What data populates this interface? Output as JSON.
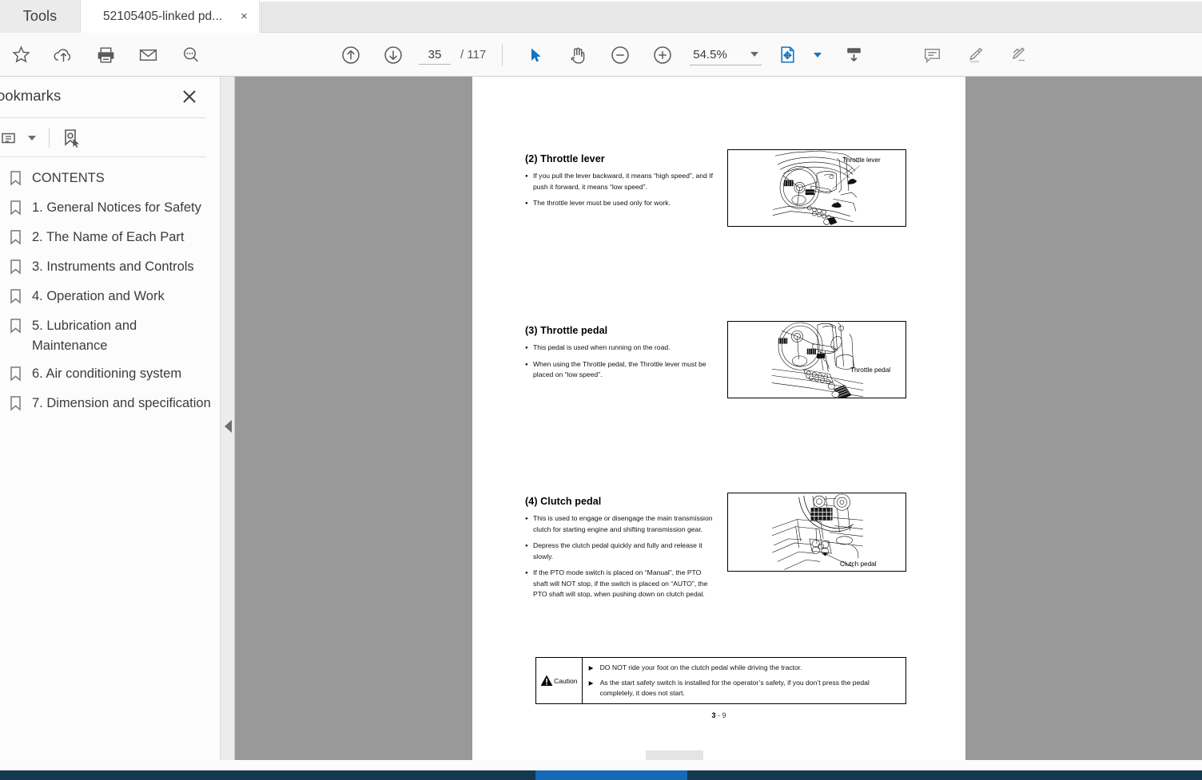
{
  "app": {
    "tools_tab_label": "Tools",
    "document_tab_title": "52105405-linked pd...",
    "close_tab_label": "×"
  },
  "toolbar": {
    "page_current": "35",
    "page_total": "/ 117",
    "zoom_level": "54.5%",
    "icons": {
      "star": "star-icon",
      "upload_cloud": "cloud-upload-icon",
      "print": "print-icon",
      "email": "email-icon",
      "search": "search-icon",
      "previous_page": "arrow-up-circle-icon",
      "next_page": "arrow-down-circle-icon",
      "select": "cursor-select-icon",
      "hand": "hand-pan-icon",
      "zoom_out": "minus-circle-icon",
      "zoom_in": "plus-circle-icon",
      "fit_page": "fit-page-icon",
      "scroll_mode": "scroll-mode-icon",
      "comment": "comment-icon",
      "highlight": "highlighter-icon",
      "sign": "sign-pen-icon"
    }
  },
  "panel": {
    "title": "ookmarks",
    "close_label": "✕",
    "options_icon": "list-options-icon",
    "new_bookmark_icon": "new-bookmark-icon",
    "items": [
      {
        "label": "CONTENTS"
      },
      {
        "label": "1. General Notices for Safety"
      },
      {
        "label": "2. The Name of Each Part"
      },
      {
        "label": "3. Instruments and Controls"
      },
      {
        "label": "4. Operation and Work"
      },
      {
        "label": "5. Lubrication and Maintenance"
      },
      {
        "label": "6. Air conditioning system"
      },
      {
        "label": "7. Dimension and specification"
      }
    ]
  },
  "document": {
    "page_footer_number": "3",
    "page_footer_sep": "-",
    "page_footer_sub": "9",
    "sections": [
      {
        "heading": "(2) Throttle lever",
        "bullets": [
          "If you pull the lever backward, it means “high speed”, and If push it forward, it means “low speed”.",
          "The throttle lever must be used only for work."
        ],
        "figure_label": "Throttle lever"
      },
      {
        "heading": "(3) Throttle pedal",
        "bullets": [
          "This pedal is used when running on the road.",
          "When using the Throttle pedal, the Throttle lever must be placed on “low speed”."
        ],
        "figure_label": "Throttle pedal"
      },
      {
        "heading": "(4) Clutch pedal",
        "bullets": [
          "This is used to engage or disengage the main transmission clutch for starting engine and shifting transmission gear.",
          "Depress the clutch pedal quickly and fully and release it slowly.",
          "If the PTO mode switch is placed on “Manual”, the PTO shaft will NOT stop, if the switch is placed on “AUTO”, the PTO shaft will stop, when pushing down on clutch pedal."
        ],
        "figure_label": "Clutch pedal"
      }
    ],
    "caution": {
      "word": "Caution",
      "lines": [
        "DO NOT ride your foot on the clutch pedal while driving the tractor.",
        "As the start safety switch is installed for the operator’s safety, if you don’t press the pedal completely, it does not start."
      ]
    }
  },
  "colors": {
    "accent_blue": "#1473c6",
    "doc_background": "#999999",
    "taskbar": "#16384f",
    "taskbar_active": "#1668b8"
  }
}
